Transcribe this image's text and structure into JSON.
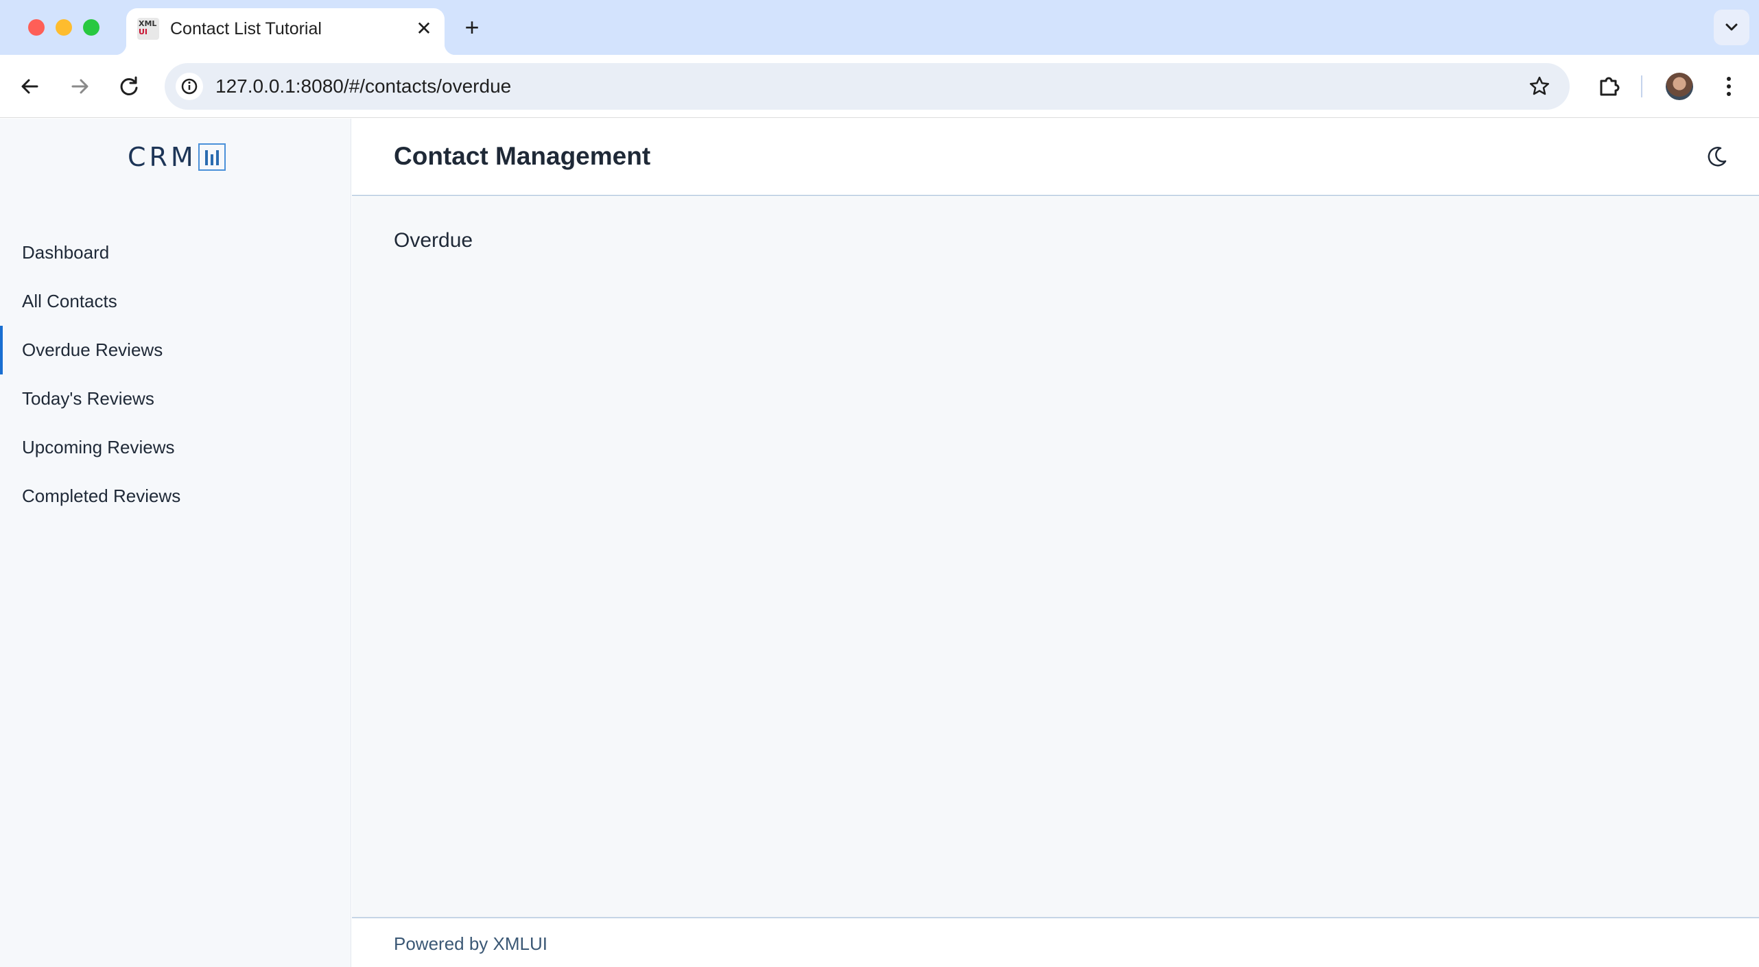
{
  "browser": {
    "tab": {
      "title": "Contact List Tutorial",
      "favicon_top": "XML",
      "favicon_bottom": "UI"
    },
    "address": {
      "url": "127.0.0.1:8080/#/contacts/overdue"
    }
  },
  "app": {
    "logo": {
      "text": "CRM"
    },
    "header": {
      "title": "Contact Management"
    },
    "nav": {
      "items": [
        {
          "label": "Dashboard"
        },
        {
          "label": "All Contacts"
        },
        {
          "label": "Overdue Reviews",
          "active": true
        },
        {
          "label": "Today's Reviews"
        },
        {
          "label": "Upcoming Reviews"
        },
        {
          "label": "Completed Reviews"
        }
      ]
    },
    "main": {
      "section_title": "Overdue"
    },
    "footer": {
      "text": "Powered by XMLUI"
    }
  },
  "colors": {
    "accent": "#1a6fd1",
    "tabbar_bg": "#d3e3fd",
    "sidebar_bg": "#f6f8fb"
  },
  "icons": {
    "theme_toggle": "moon-icon",
    "star": "star-icon",
    "extensions": "puzzle-icon"
  }
}
